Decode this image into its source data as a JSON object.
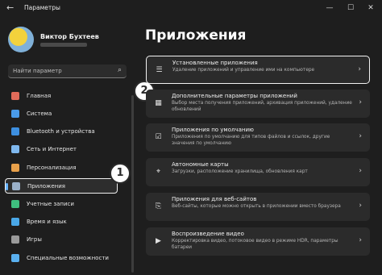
{
  "window": {
    "title": "Параметры",
    "back": "←",
    "minimize": "—",
    "maximize": "☐",
    "close": "✕"
  },
  "user": {
    "name": "Виктор Бухтеев"
  },
  "search": {
    "placeholder": "Найти параметр",
    "icon": "search-icon"
  },
  "sidebar": {
    "items": [
      {
        "label": "Главная",
        "icon": "home-icon",
        "color": "#e06b5a"
      },
      {
        "label": "Система",
        "icon": "system-icon",
        "color": "#4a9bea"
      },
      {
        "label": "Bluetooth и устройства",
        "icon": "bluetooth-icon",
        "color": "#3d8fe0"
      },
      {
        "label": "Сеть и Интернет",
        "icon": "network-icon",
        "color": "#7fb8ee"
      },
      {
        "label": "Персонализация",
        "icon": "brush-icon",
        "color": "#e8a04a"
      },
      {
        "label": "Приложения",
        "icon": "apps-icon",
        "color": "#9ab0c8",
        "active": true
      },
      {
        "label": "Учетные записи",
        "icon": "account-icon",
        "color": "#3fbf7f"
      },
      {
        "label": "Время и язык",
        "icon": "clock-globe-icon",
        "color": "#4aa8e8"
      },
      {
        "label": "Игры",
        "icon": "gamepad-icon",
        "color": "#9a9a9a"
      },
      {
        "label": "Специальные возможности",
        "icon": "accessibility-icon",
        "color": "#5ab0ef"
      }
    ]
  },
  "badges": [
    "1",
    "2"
  ],
  "main": {
    "heading": "Приложения",
    "cards": [
      {
        "title": "Установленные приложения",
        "desc": "Удаление приложений и управление ими на компьютере",
        "icon": "list-icon",
        "glyph": "☰",
        "selected": true
      },
      {
        "title": "Дополнительные параметры приложений",
        "desc": "Выбор места получения приложений, архивация приложений, удаление обновлений",
        "icon": "apps-settings-icon",
        "glyph": "▦"
      },
      {
        "title": "Приложения по умолчанию",
        "desc": "Приложения по умолчанию для типов файлов и ссылок, другие значения по умолчанию",
        "icon": "default-apps-icon",
        "glyph": "☑"
      },
      {
        "title": "Автономные карты",
        "desc": "Загрузки, расположение хранилища, обновления карт",
        "icon": "map-icon",
        "glyph": "⌖"
      },
      {
        "title": "Приложения для веб-сайтов",
        "desc": "Веб-сайты, которые можно открыть в приложении вместо браузера",
        "icon": "web-apps-icon",
        "glyph": "⎘"
      },
      {
        "title": "Воспроизведение видео",
        "desc": "Корректировка видео, потоковое видео в режиме HDR, параметры батареи",
        "icon": "video-icon",
        "glyph": "▶"
      }
    ],
    "chevron": "›"
  }
}
